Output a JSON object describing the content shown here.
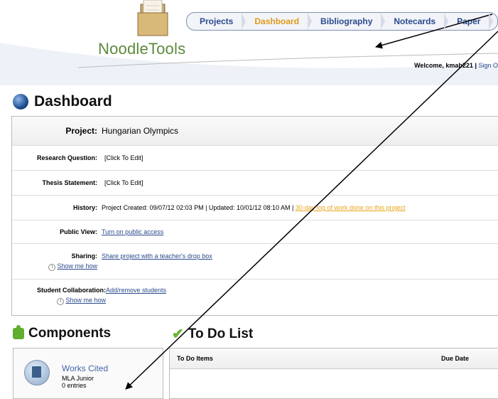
{
  "app": {
    "logo_text": "NoodleTools"
  },
  "nav": {
    "tabs": [
      "Projects",
      "Dashboard",
      "Bibliography",
      "Notecards",
      "Paper"
    ],
    "active_index": 1
  },
  "user": {
    "welcome_prefix": "Welcome, kmab221",
    "sign_out": "Sign O"
  },
  "dashboard": {
    "title": "Dashboard",
    "project_label": "Project:",
    "project_value": "Hungarian Olympics",
    "research_label": "Research Question:",
    "research_value": "[Click To Edit]",
    "thesis_label": "Thesis Statement:",
    "thesis_value": "[Click To Edit]",
    "history_label": "History:",
    "history_value": "Project Created: 09/07/12 02:03 PM | Updated: 10/01/12 08:10 AM |",
    "history_link": "30-day log of work done on this project",
    "public_label": "Public View:",
    "public_link": "Turn on public access",
    "sharing_label": "Sharing:",
    "sharing_link": "Share project with a teacher's drop box",
    "collab_label": "Student Collaboration:",
    "collab_link": "Add/remove students",
    "show_me_how": "Show me how"
  },
  "components": {
    "title": "Components",
    "item_title": "Works Cited",
    "item_style": "MLA Junior",
    "item_count": "0 entries"
  },
  "todo": {
    "title": "To Do List",
    "col_items": "To Do Items",
    "col_due": "Due Date"
  },
  "colors": {
    "accent": "#e09a1a",
    "link": "#2a4a8c",
    "logo_green": "#5b8a3a"
  }
}
